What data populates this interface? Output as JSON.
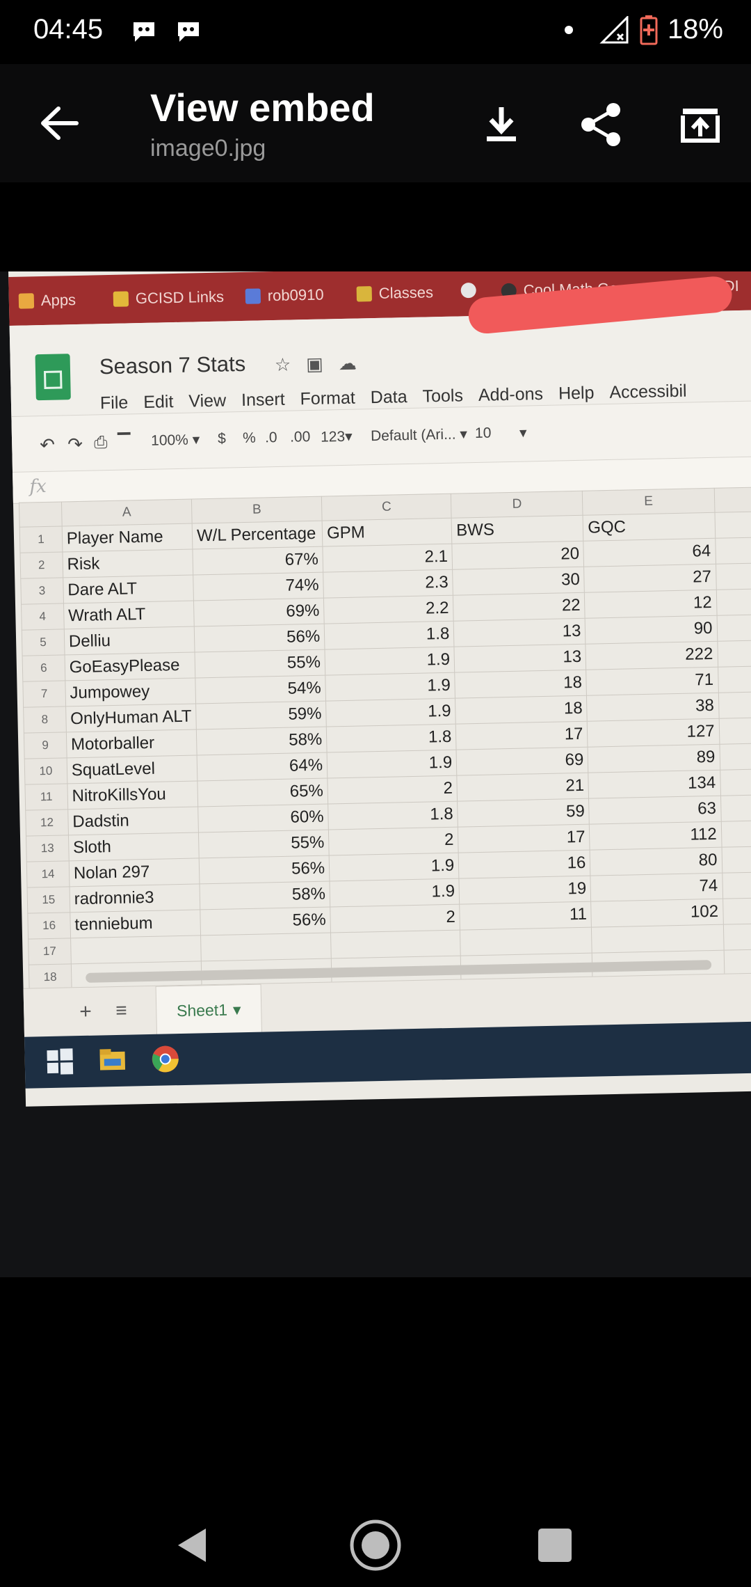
{
  "status_bar": {
    "time": "04:45",
    "battery": "18%",
    "icons": [
      "discord-notification-icon",
      "discord-notification-icon",
      "dot-icon",
      "signal-icon",
      "battery-icon"
    ]
  },
  "app_bar": {
    "title": "View embed",
    "subtitle": "image0.jpg",
    "icons": [
      "back-arrow-icon",
      "download-icon",
      "share-icon",
      "open-external-icon"
    ]
  },
  "photo": {
    "bookmarks": [
      {
        "label": "Apps",
        "icon": "apps-grid-icon"
      },
      {
        "label": "GCISD Links",
        "icon": "folder-icon"
      },
      {
        "label": "rob0910",
        "icon": "bookmark-icon"
      },
      {
        "label": "Classes",
        "icon": "classroom-icon"
      },
      {
        "label": "",
        "icon": "globe-icon"
      },
      {
        "label": "Cool Math Games -...",
        "icon": "rocket-icon"
      },
      {
        "label": "DI",
        "icon": "globe-icon"
      }
    ],
    "document": {
      "title": "Season 7 Stats",
      "menu": [
        "File",
        "Edit",
        "View",
        "Insert",
        "Format",
        "Data",
        "Tools",
        "Add-ons",
        "Help",
        "Accessibil"
      ]
    },
    "toolbar": {
      "zoom": "100%",
      "currency": "$",
      "percent": "%",
      "dec_decrease": ".0",
      "dec_increase": ".00",
      "number_format": "123",
      "font": "Default (Ari...",
      "font_size": "10"
    },
    "formula_bar": {
      "fx": "fx"
    },
    "columns": [
      "A",
      "B",
      "C",
      "D",
      "E"
    ],
    "header": [
      "Player Name",
      "W/L Percentage",
      "GPM",
      "BWS",
      "GQC"
    ],
    "rows": [
      [
        "Risk",
        "67%",
        "2.1",
        "20",
        "64"
      ],
      [
        "Dare ALT",
        "74%",
        "2.3",
        "30",
        "27"
      ],
      [
        "Wrath ALT",
        "69%",
        "2.2",
        "22",
        "12"
      ],
      [
        "Delliu",
        "56%",
        "1.8",
        "13",
        "90"
      ],
      [
        "GoEasyPlease",
        "55%",
        "1.9",
        "13",
        "222"
      ],
      [
        "Jumpowey",
        "54%",
        "1.9",
        "18",
        "71"
      ],
      [
        "OnlyHuman ALT",
        "59%",
        "1.9",
        "18",
        "38"
      ],
      [
        "Motorballer",
        "58%",
        "1.8",
        "17",
        "127"
      ],
      [
        "SquatLevel",
        "64%",
        "1.9",
        "69",
        "89"
      ],
      [
        "NitroKillsYou",
        "65%",
        "2",
        "21",
        "134"
      ],
      [
        "Dadstin",
        "60%",
        "1.8",
        "59",
        "63"
      ],
      [
        "Sloth",
        "55%",
        "2",
        "17",
        "112"
      ],
      [
        "Nolan 297",
        "56%",
        "1.9",
        "16",
        "80"
      ],
      [
        "radronnie3",
        "58%",
        "1.9",
        "19",
        "74"
      ],
      [
        "tenniebum",
        "56%",
        "2",
        "11",
        "102"
      ]
    ],
    "row_numbers": [
      "1",
      "2",
      "3",
      "4",
      "5",
      "6",
      "7",
      "8",
      "9",
      "10",
      "11",
      "12",
      "13",
      "14",
      "15",
      "16",
      "17",
      "18"
    ],
    "sheet_tab": "Sheet1",
    "colors": {
      "bookmark_bar": "#9e2e2e",
      "sheets_green": "#2e9a59",
      "redaction": "#f15a5a",
      "taskbar": "#1d2f43"
    }
  },
  "nav_bar": {
    "icons": [
      "back-triangle-icon",
      "home-circle-icon",
      "recents-square-icon"
    ]
  }
}
